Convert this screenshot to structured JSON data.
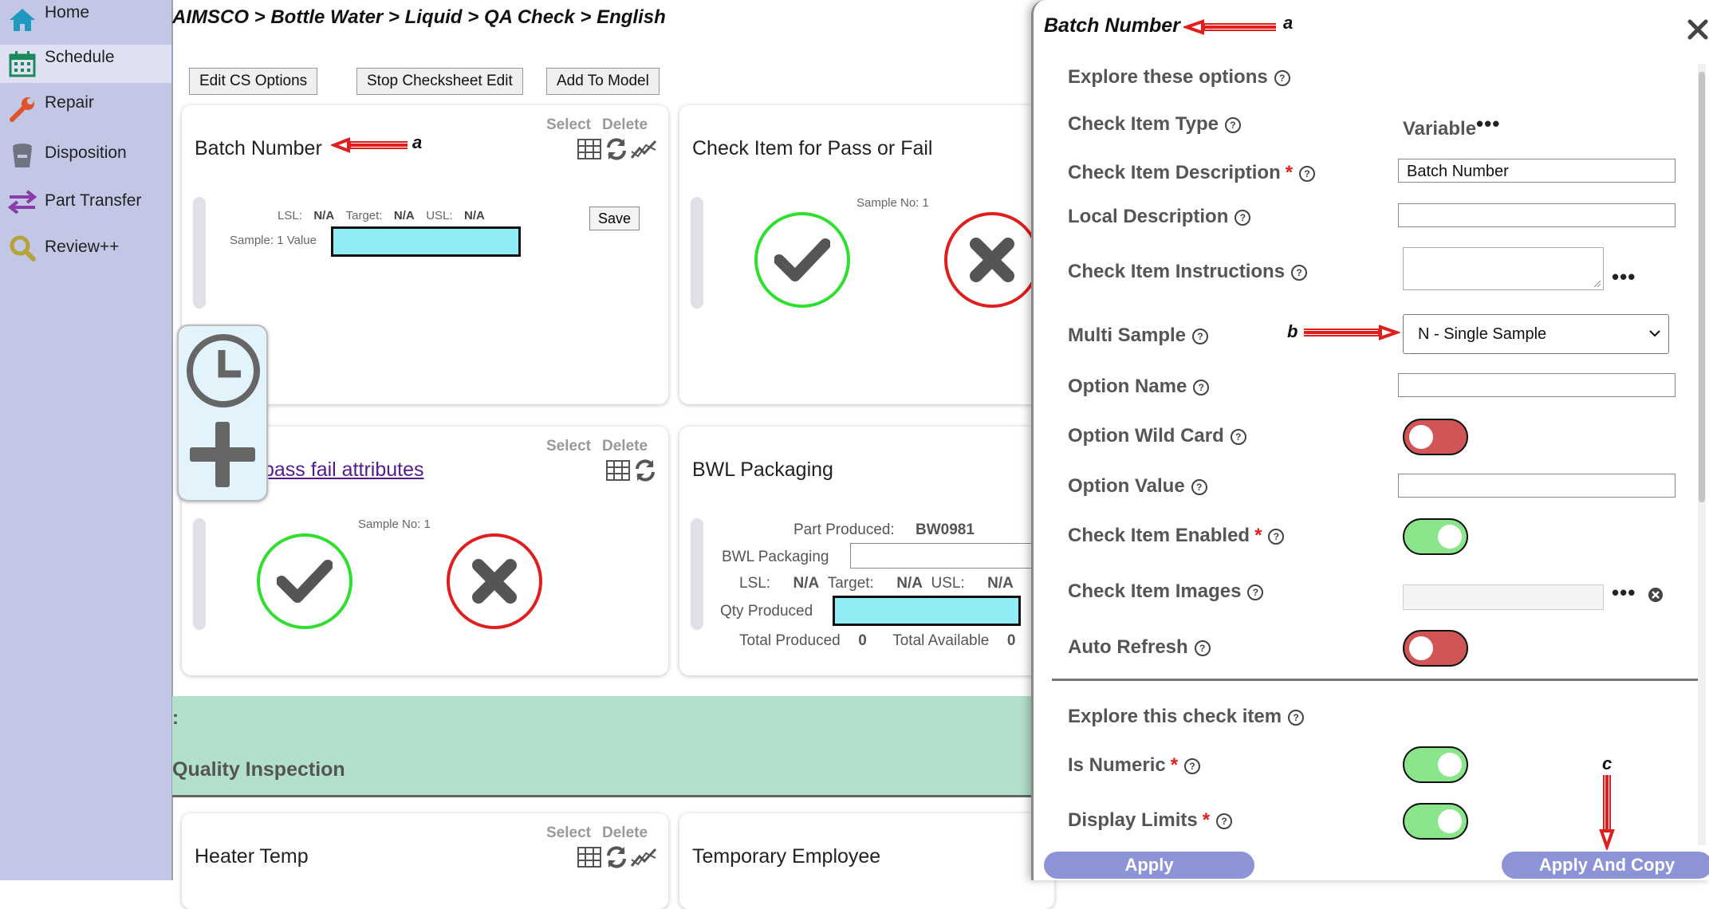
{
  "sidebar": {
    "items": [
      {
        "label": "Home",
        "icon": "home-icon"
      },
      {
        "label": "Schedule",
        "icon": "calendar-icon"
      },
      {
        "label": "Repair",
        "icon": "wrench-icon"
      },
      {
        "label": "Disposition",
        "icon": "trash-bin-icon"
      },
      {
        "label": "Part Transfer",
        "icon": "transfer-arrows-icon"
      },
      {
        "label": "Review++",
        "icon": "magnifier-icon"
      }
    ]
  },
  "breadcrumb": "AIMSCO > Bottle Water > Liquid > QA Check > English",
  "toolbar": {
    "edit_cs_options": "Edit CS Options",
    "stop_checksheet_edit": "Stop Checksheet Edit",
    "add_to_model": "Add To Model"
  },
  "cards": {
    "batch": {
      "title": "Batch Number",
      "select": "Select",
      "delete": "Delete",
      "lsl_label": "LSL:",
      "lsl": "N/A",
      "target_label": "Target:",
      "target": "N/A",
      "usl_label": "USL:",
      "usl": "N/A",
      "sample_label": "Sample: 1 Value",
      "save": "Save"
    },
    "passfail": {
      "title": "Check Item for Pass or Fail",
      "sample_no": "Sample No: 1"
    },
    "attributes": {
      "title": "pass fail attributes",
      "select": "Select",
      "delete": "Delete",
      "sample_no": "Sample No: 1"
    },
    "bwl": {
      "title": "BWL Packaging",
      "part_produced_label": "Part Produced:",
      "part_produced": "BW0981",
      "bwl_packaging_label": "BWL Packaging",
      "lsl_label": "LSL:",
      "lsl": "N/A",
      "target_label": "Target:",
      "target": "N/A",
      "usl_label": "USL:",
      "usl": "N/A",
      "qty_produced_label": "Qty Produced",
      "total_produced_label": "Total Produced",
      "total_produced": "0",
      "total_available_label": "Total Available",
      "total_available": "0"
    },
    "heater": {
      "title": "Heater Temp",
      "select": "Select",
      "delete": "Delete"
    },
    "temp_employee": {
      "title": "Temporary Employee"
    }
  },
  "section": {
    "colon": ":",
    "title": "Quality Inspection"
  },
  "panel": {
    "title": "Batch Number",
    "explore_options": "Explore these options",
    "check_item_type_label": "Check Item Type",
    "check_item_type_value": "Variable",
    "check_item_description_label": "Check Item Description",
    "check_item_description_value": "Batch Number",
    "local_description_label": "Local Description",
    "check_item_instructions_label": "Check Item Instructions",
    "multi_sample_label": "Multi Sample",
    "multi_sample_value": "N - Single Sample",
    "option_name_label": "Option Name",
    "option_wild_card_label": "Option Wild Card",
    "option_value_label": "Option Value",
    "check_item_enabled_label": "Check Item Enabled",
    "check_item_images_label": "Check Item Images",
    "auto_refresh_label": "Auto Refresh",
    "explore_check_item": "Explore this check item",
    "is_numeric_label": "Is Numeric",
    "display_limits_label": "Display Limits",
    "apply": "Apply",
    "apply_and_copy": "Apply And Copy",
    "toggles": {
      "option_wild_card": false,
      "check_item_enabled": true,
      "auto_refresh": false,
      "is_numeric": true,
      "display_limits": true
    }
  },
  "annotations": {
    "a": "a",
    "b": "b",
    "c": "c"
  },
  "colors": {
    "sidebar": "#c3c7e6",
    "band": "#b2e0cc",
    "pass": "#2ee02e",
    "fail": "#e01e1e",
    "cyan_input": "#91ecf6",
    "toggle_on": "#8be68b",
    "toggle_off": "#d25555",
    "panel_button": "#8c93d6",
    "annotation_arrow": "#e01e1e"
  }
}
